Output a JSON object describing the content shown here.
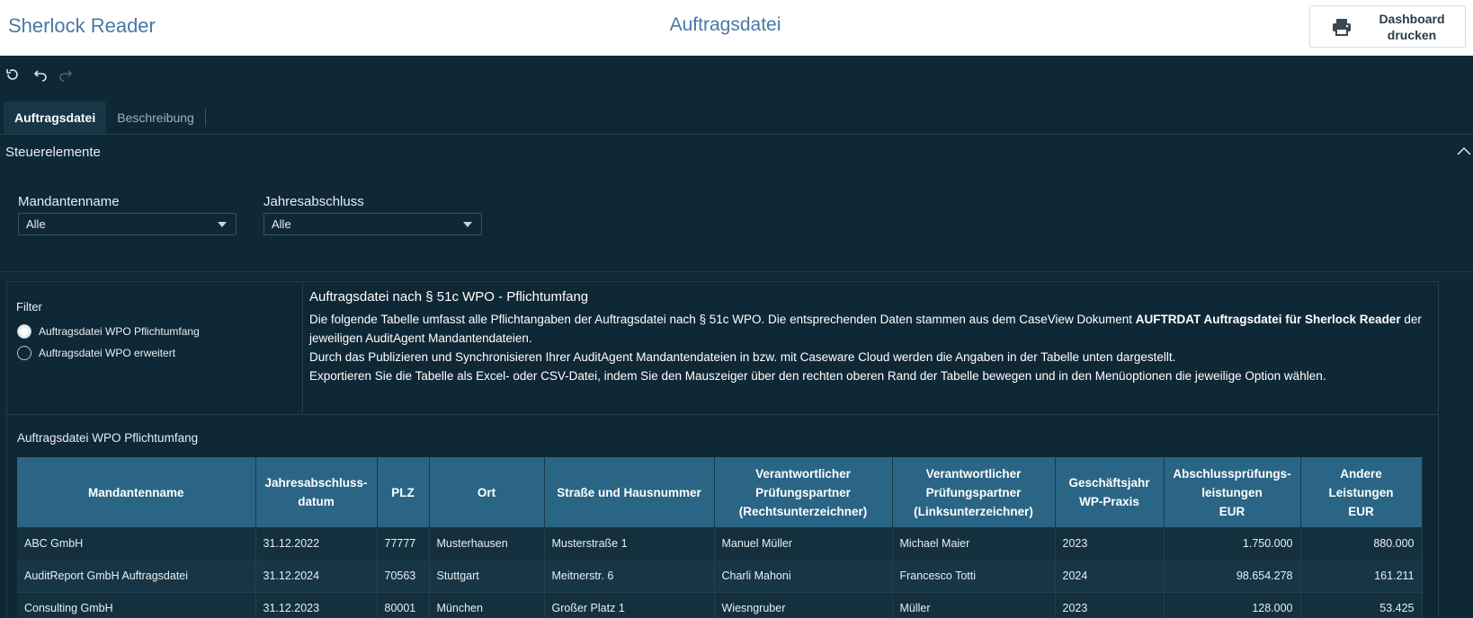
{
  "header": {
    "app_title": "Sherlock Reader",
    "page_title": "Auftragsdatei",
    "print_button": "Dashboard\ndrucken",
    "print_icon": "printer-icon"
  },
  "toolbar": {
    "icons": [
      "reset-icon",
      "undo-icon",
      "redo-icon"
    ]
  },
  "tabs": [
    {
      "label": "Auftragsdatei",
      "active": true
    },
    {
      "label": "Beschreibung",
      "active": false
    }
  ],
  "controls_section": {
    "title": "Steuerelemente",
    "controls": [
      {
        "label": "Mandantenname",
        "value": "Alle"
      },
      {
        "label": "Jahresabschluss",
        "value": "Alle"
      }
    ]
  },
  "filter": {
    "title": "Filter",
    "options": [
      {
        "label": "Auftragsdatei WPO Pflichtumfang",
        "selected": true
      },
      {
        "label": "Auftragsdatei WPO erweitert",
        "selected": false
      }
    ]
  },
  "description": {
    "title": "Auftragsdatei nach § 51c WPO - Pflichtumfang",
    "line1_a": "Die folgende Tabelle umfasst alle Pflichtangaben der Auftragsdatei nach § 51c WPO. Die entsprechenden Daten stammen aus dem CaseView Dokument ",
    "line1_bold": "AUFTRDAT Auftragsdatei für Sherlock Reader",
    "line1_b": " der jeweiligen AuditAgent Mandantendateien.",
    "line2": "Durch das Publizieren und Synchronisieren Ihrer AuditAgent Mandantendateien in bzw. mit Caseware Cloud werden die Angaben in der Tabelle unten dargestellt.",
    "line3": "Exportieren Sie die Tabelle als Excel- oder CSV-Datei, indem Sie den Mauszeiger über den rechten oberen Rand der Tabelle bewegen und in den Menüoptionen die jeweilige Option wählen."
  },
  "table": {
    "title": "Auftragsdatei WPO Pflichtumfang",
    "columns": [
      "Mandantenname",
      "Jahresabschluss-\ndatum",
      "PLZ",
      "Ort",
      "Straße und Hausnummer",
      "Verantwortlicher\nPrüfungspartner\n(Rechtsunterzeichner)",
      "Verantwortlicher\nPrüfungspartner\n(Linksunterzeichner)",
      "Geschäftsjahr\nWP-Praxis",
      "Abschlussprüfungs-\nleistungen\nEUR",
      "Andere\nLeistungen\nEUR"
    ],
    "rows": [
      [
        "ABC GmbH",
        "31.12.2022",
        "77777",
        "Musterhausen",
        "Musterstraße 1",
        "Manuel Müller",
        "Michael Maier",
        "2023",
        "1.750.000",
        "880.000"
      ],
      [
        "AuditReport GmbH Auftragsdatei",
        "31.12.2024",
        "70563",
        "Stuttgart",
        "Meitnerstr. 6",
        "Charli Mahoni",
        "Francesco Totti",
        "2024",
        "98.654.278",
        "161.211"
      ],
      [
        "Consulting GmbH",
        "31.12.2023",
        "80001",
        "München",
        "Großer Platz 1",
        "Wiesngruber",
        "Müller",
        "2023",
        "128.000",
        "53.425"
      ]
    ]
  }
}
